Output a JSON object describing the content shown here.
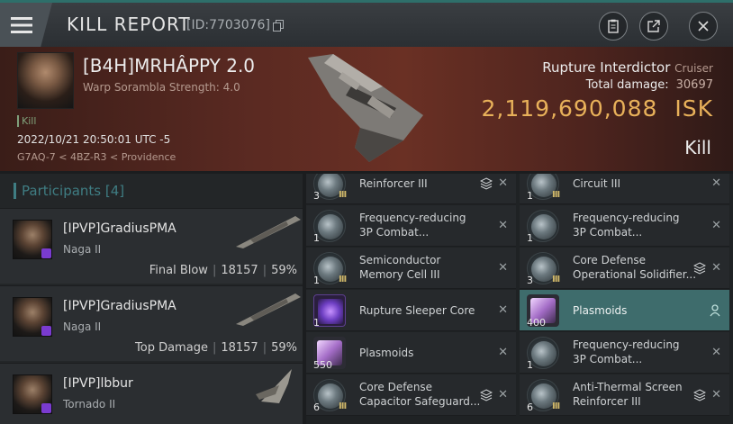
{
  "header": {
    "title": "KILL REPORT",
    "kill_id": "[ID:7703076]"
  },
  "victim": {
    "pilot_name": "[B4H]MRHÂPPY 2.0",
    "scram_label": "Warp Sorambla Strength: 4.0",
    "kill_tag": "Kill",
    "datetime": "2022/10/21 20:50:01 UTC -5",
    "location": "G7AQ-7 < 4BZ-R3 < Providence",
    "ship_name": "Rupture Interdictor",
    "ship_class": "Cruiser",
    "total_damage_label": "Total damage:",
    "total_damage": "30697",
    "isk_value": "2,119,690,088",
    "isk_unit": "ISK",
    "result": "Kill"
  },
  "participants": {
    "header": "Participants [4]",
    "rows": [
      {
        "name": "[IPVP]GradiusPMA",
        "ship": "Naga II",
        "role": "Final Blow",
        "damage": "18157",
        "percent": "59%"
      },
      {
        "name": "[IPVP]GradiusPMA",
        "ship": "Naga II",
        "role": "Top Damage",
        "damage": "18157",
        "percent": "59%"
      },
      {
        "name": "[IPVP]lbbur",
        "ship": "Tornado II",
        "role": "",
        "damage": "",
        "percent": ""
      }
    ]
  },
  "items": {
    "left": [
      {
        "qty": "3",
        "meta": "III",
        "name_l1": "Reinforcer III",
        "name_l2": "",
        "stack": true
      },
      {
        "qty": "1",
        "meta": "",
        "name_l1": "Frequency-reducing",
        "name_l2": "3P Combat...",
        "stack": false
      },
      {
        "qty": "1",
        "meta": "III",
        "name_l1": "Semiconductor",
        "name_l2": "Memory Cell III",
        "stack": false
      },
      {
        "qty": "1",
        "meta": "",
        "name_l1": "Rupture Sleeper Core",
        "name_l2": "",
        "stack": false
      },
      {
        "qty": "550",
        "meta": "",
        "name_l1": "Plasmoids",
        "name_l2": "",
        "stack": false
      },
      {
        "qty": "6",
        "meta": "III",
        "name_l1": "Core Defense",
        "name_l2": "Capacitor Safeguard...",
        "stack": true
      }
    ],
    "right": [
      {
        "qty": "1",
        "meta": "III",
        "name_l1": "Circuit III",
        "name_l2": "",
        "stack": false
      },
      {
        "qty": "1",
        "meta": "",
        "name_l1": "Frequency-reducing",
        "name_l2": "3P Combat...",
        "stack": false
      },
      {
        "qty": "3",
        "meta": "III",
        "name_l1": "Core Defense",
        "name_l2": "Operational Solidifier...",
        "stack": true
      },
      {
        "qty": "400",
        "meta": "",
        "name_l1": "Plasmoids",
        "name_l2": "",
        "stack": false
      },
      {
        "qty": "1",
        "meta": "",
        "name_l1": "Frequency-reducing",
        "name_l2": "3P Combat...",
        "stack": false
      },
      {
        "qty": "6",
        "meta": "III",
        "name_l1": "Anti-Thermal Screen",
        "name_l2": "Reinforcer III",
        "stack": true
      }
    ]
  }
}
